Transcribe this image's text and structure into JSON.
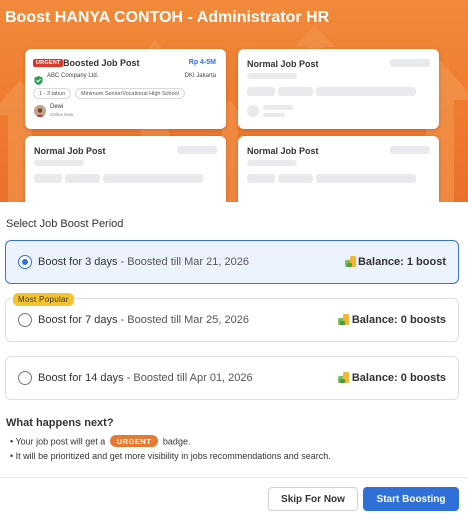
{
  "header": {
    "title": "Boost HANYA CONTOH - Administrator HR"
  },
  "preview": {
    "boosted_card": {
      "urgent_tag": "URGENT",
      "title": "Boosted Job Post",
      "salary": "Rp 4-5M",
      "company": "ABC Company Ltd.",
      "location": "DKI Jakarta",
      "chips": [
        "1 - 3 tahun",
        "Minimum Senior/Vocational High School"
      ],
      "recruiter_name": "Dewi",
      "recruiter_status": "Online Now"
    },
    "normal_card_title": "Normal Job Post"
  },
  "boost": {
    "section_title": "Select Job Boost Period",
    "popular_tag": "Most Popular",
    "options": [
      {
        "duration": "Boost for 3 days",
        "separator": " - ",
        "until": "Boosted till Mar 21, 2026",
        "balance": "Balance: 1 boost",
        "selected": true
      },
      {
        "duration": "Boost for 7 days",
        "separator": " - ",
        "until": "Boosted till Mar 25, 2026",
        "balance": "Balance: 0 boosts",
        "selected": false
      },
      {
        "duration": "Boost for 14 days",
        "separator": " - ",
        "until": "Boosted till Apr 01, 2026",
        "balance": "Balance: 0 boosts",
        "selected": false
      }
    ]
  },
  "next": {
    "title": "What happens next?",
    "bullet1_pre": "• Your job post will get a",
    "badge": "URGENT",
    "bullet1_post": "badge.",
    "bullet2": "• It will be prioritized and get more visibility in jobs recommendations and search."
  },
  "footer": {
    "skip_label": "Skip For Now",
    "start_label": "Start Boosting"
  },
  "colors": {
    "hero_orange": "#ee7a2e",
    "primary_blue": "#2e6fd8",
    "urgent_red": "#d93a2b",
    "popular_yellow": "#f4c430",
    "urgent_badge_orange": "#e67a33"
  }
}
